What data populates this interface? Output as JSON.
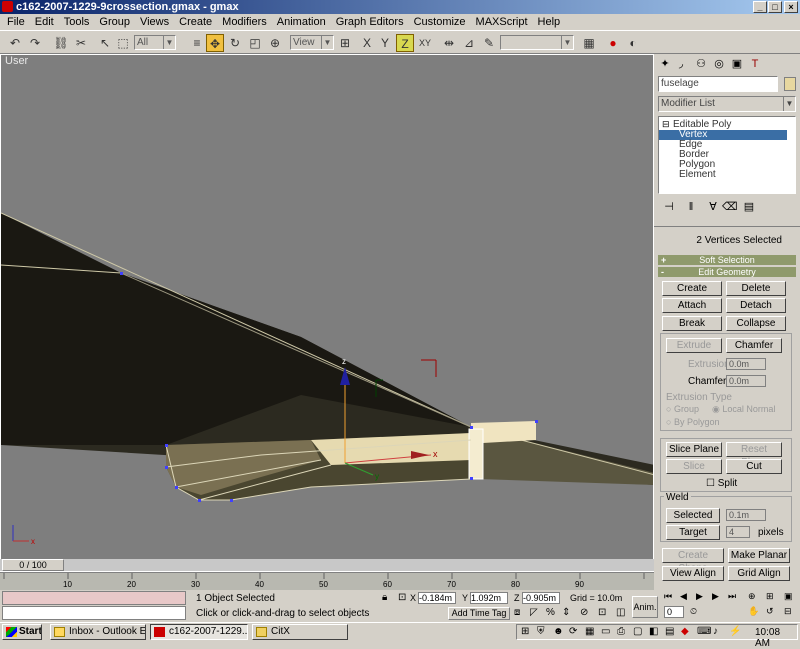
{
  "window": {
    "title": "c162-2007-1229-9crossection.gmax - gmax"
  },
  "menu": [
    "File",
    "Edit",
    "Tools",
    "Group",
    "Views",
    "Create",
    "Modifiers",
    "Animation",
    "Graph Editors",
    "Customize",
    "MAXScript",
    "Help"
  ],
  "toolbar": {
    "filter_value": "All",
    "coord_system": "View"
  },
  "viewport": {
    "label": "User"
  },
  "panel": {
    "object_name": "fuselage",
    "modifier_list": "Modifier List",
    "stack_root": "Editable Poly",
    "stack_items": [
      "Vertex",
      "Edge",
      "Border",
      "Polygon",
      "Element"
    ],
    "selection_status": "2 Vertices Selected",
    "rollouts": {
      "soft_selection": "Soft Selection",
      "edit_geometry": "Edit Geometry"
    },
    "buttons": {
      "create": "Create",
      "delete": "Delete",
      "attach": "Attach",
      "detach": "Detach",
      "break": "Break",
      "collapse": "Collapse",
      "extrude": "Extrude",
      "chamfer": "Chamfer",
      "slice_plane": "Slice Plane",
      "reset_plane": "Reset Plane",
      "slice": "Slice",
      "cut": "Cut",
      "selected": "Selected",
      "target": "Target",
      "create_shape": "Create Shape",
      "make_planar": "Make Planar",
      "view_align": "View Align",
      "grid_align": "Grid Align"
    },
    "labels": {
      "extrusion": "Extrusion",
      "chamfer": "Chamfer",
      "extrusion_type": "Extrusion Type",
      "group": "Group",
      "local_normal": "Local Normal",
      "by_polygon": "By Polygon",
      "split": "Split",
      "weld": "Weld",
      "pixels": "pixels"
    },
    "values": {
      "extrusion": "0.0m",
      "chamfer": "0.0m",
      "weld_selected": "0.1m",
      "weld_target": "4"
    }
  },
  "timeline": {
    "frame": "0 / 100",
    "ticks": [
      "10",
      "20",
      "30",
      "40",
      "50",
      "60",
      "70",
      "80",
      "90"
    ]
  },
  "status": {
    "objects": "1 Object Selected",
    "prompt": "Click or click-and-drag to select objects",
    "x": "-0.184m",
    "y": "1.092m",
    "z": "-0.905m",
    "grid": "Grid = 10.0m",
    "add_time_tag": "Add Time Tag",
    "anim": "Anim.",
    "frame_field": "0"
  },
  "taskbar": {
    "start": "Start",
    "tasks": [
      "Inbox - Outlook E...",
      "c162-2007-1229...",
      "CitX"
    ],
    "clock": "10:08 AM"
  },
  "colors": {
    "viewport_bg": "#7e7e7e",
    "fuselage_dark": "#3a3520",
    "fuselage_light": "#e8dcb4",
    "rollout": "#8f9a6c",
    "selection": "#3a6ea5"
  }
}
